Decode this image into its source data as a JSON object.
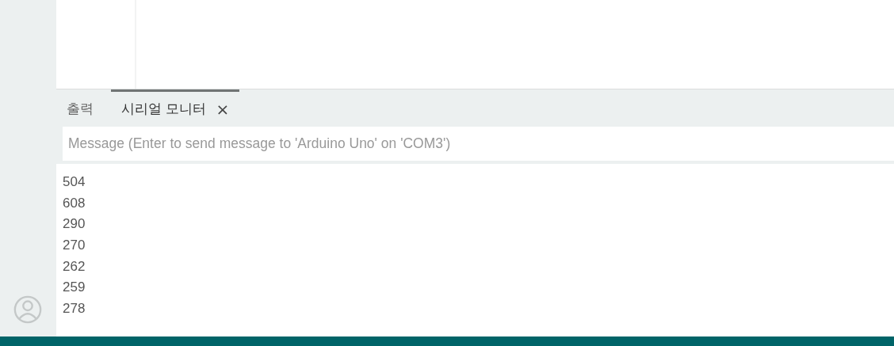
{
  "panel_tabs": [
    {
      "label": "출력",
      "selected": false
    },
    {
      "label": "시리얼 모니터",
      "selected": true,
      "close": "×"
    }
  ],
  "message_input": {
    "placeholder": "Message (Enter to send message to 'Arduino Uno' on 'COM3')"
  },
  "serial_output": [
    "504",
    "608",
    "290",
    "270",
    "262",
    "259",
    "278"
  ]
}
